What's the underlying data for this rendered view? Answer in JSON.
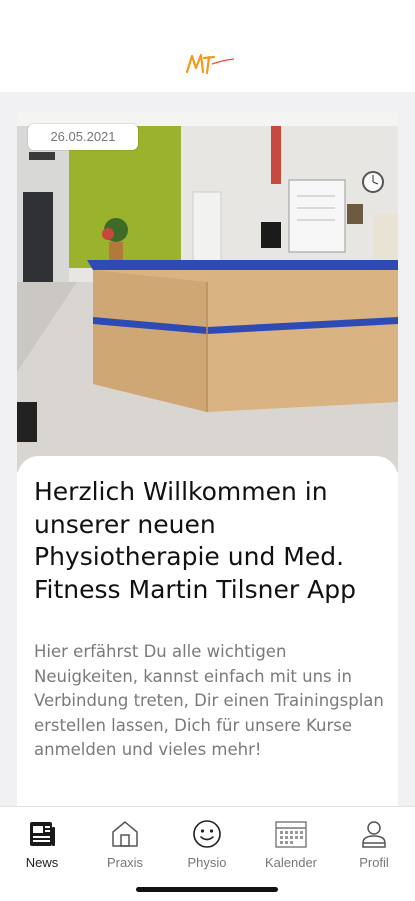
{
  "header": {
    "logo_icon": "mt-logo-icon"
  },
  "news": {
    "date": "26.05.2021",
    "title": "Herzlich Willkommen in unserer neuen Physiotherapie und Med. Fitness Martin Tilsner App",
    "body": "Hier erfährst Du alle wichtigen Neuigkeiten, kannst einfach mit uns in Verbindung treten, Dir einen Trainingsplan erstellen lassen, Dich für unsere Kurse anmelden und vieles mehr!"
  },
  "tabs": [
    {
      "label": "News",
      "icon": "newspaper-icon",
      "active": true
    },
    {
      "label": "Praxis",
      "icon": "house-icon",
      "active": false
    },
    {
      "label": "Physio",
      "icon": "smiley-icon",
      "active": false
    },
    {
      "label": "Kalender",
      "icon": "calendar-icon",
      "active": false
    },
    {
      "label": "Profil",
      "icon": "user-icon",
      "active": false
    }
  ],
  "colors": {
    "accent": "#f39a1e",
    "active_tab": "#222222",
    "inactive_tab": "#777777"
  }
}
